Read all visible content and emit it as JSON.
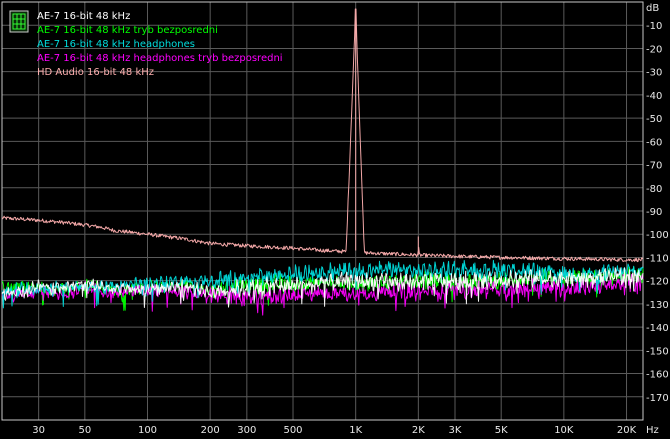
{
  "chart_data": {
    "type": "line",
    "x_scale": "log",
    "xlim": [
      20,
      24000
    ],
    "ylim": [
      -180,
      0
    ],
    "y_unit": "dB",
    "x_unit": "Hz",
    "grid": true,
    "legend_placement": "top-left",
    "x_ticks": [
      {
        "value": 30,
        "label": "30"
      },
      {
        "value": 50,
        "label": "50"
      },
      {
        "value": 100,
        "label": "100"
      },
      {
        "value": 200,
        "label": "200"
      },
      {
        "value": 300,
        "label": "300"
      },
      {
        "value": 500,
        "label": "500"
      },
      {
        "value": 1000,
        "label": "1K"
      },
      {
        "value": 2000,
        "label": "2K"
      },
      {
        "value": 3000,
        "label": "3K"
      },
      {
        "value": 5000,
        "label": "5K"
      },
      {
        "value": 10000,
        "label": "10K"
      },
      {
        "value": 20000,
        "label": "20K"
      }
    ],
    "y_ticks": [
      {
        "value": -10,
        "label": "-10"
      },
      {
        "value": -20,
        "label": "-20"
      },
      {
        "value": -30,
        "label": "-30"
      },
      {
        "value": -40,
        "label": "-40"
      },
      {
        "value": -50,
        "label": "-50"
      },
      {
        "value": -60,
        "label": "-60"
      },
      {
        "value": -70,
        "label": "-70"
      },
      {
        "value": -80,
        "label": "-80"
      },
      {
        "value": -90,
        "label": "-90"
      },
      {
        "value": -100,
        "label": "-100"
      },
      {
        "value": -110,
        "label": "-110"
      },
      {
        "value": -120,
        "label": "-120"
      },
      {
        "value": -130,
        "label": "-130"
      },
      {
        "value": -140,
        "label": "-140"
      },
      {
        "value": -150,
        "label": "-150"
      },
      {
        "value": -160,
        "label": "-160"
      },
      {
        "value": -170,
        "label": "-170"
      }
    ],
    "series": [
      {
        "name": "AE-7 16-bit 48 kHz",
        "color": "#ffffff",
        "points": [
          [
            20,
            -126
          ],
          [
            25,
            -124
          ],
          [
            30,
            -122
          ],
          [
            40,
            -123
          ],
          [
            50,
            -121
          ],
          [
            70,
            -123
          ],
          [
            100,
            -124
          ],
          [
            150,
            -122
          ],
          [
            200,
            -125
          ],
          [
            300,
            -123
          ],
          [
            500,
            -122
          ],
          [
            700,
            -121
          ],
          [
            1000,
            -120
          ],
          [
            1500,
            -121
          ],
          [
            2000,
            -120
          ],
          [
            3000,
            -120
          ],
          [
            5000,
            -120
          ],
          [
            7000,
            -119
          ],
          [
            10000,
            -119
          ],
          [
            15000,
            -119
          ],
          [
            20000,
            -118
          ],
          [
            24000,
            -118
          ]
        ]
      },
      {
        "name": "AE-7 16-bit 48 kHz tryb bezposredni",
        "color": "#00ff00",
        "points": [
          [
            20,
            -123
          ],
          [
            25,
            -122
          ],
          [
            30,
            -123
          ],
          [
            40,
            -124
          ],
          [
            50,
            -122
          ],
          [
            70,
            -124
          ],
          [
            100,
            -123
          ],
          [
            150,
            -122
          ],
          [
            200,
            -124
          ],
          [
            300,
            -122
          ],
          [
            500,
            -121
          ],
          [
            700,
            -121
          ],
          [
            1000,
            -121
          ],
          [
            1500,
            -121
          ],
          [
            2000,
            -120
          ],
          [
            3000,
            -120
          ],
          [
            5000,
            -120
          ],
          [
            7000,
            -119
          ],
          [
            10000,
            -119
          ],
          [
            15000,
            -119
          ],
          [
            20000,
            -118
          ],
          [
            24000,
            -118
          ]
        ]
      },
      {
        "name": "AE-7 16-bit 48 kHz headphones",
        "color": "#00dddd",
        "points": [
          [
            20,
            -125
          ],
          [
            25,
            -123
          ],
          [
            30,
            -124
          ],
          [
            40,
            -122
          ],
          [
            50,
            -123
          ],
          [
            70,
            -122
          ],
          [
            100,
            -121
          ],
          [
            150,
            -120
          ],
          [
            200,
            -120
          ],
          [
            300,
            -119
          ],
          [
            500,
            -117
          ],
          [
            700,
            -116
          ],
          [
            1000,
            -116
          ],
          [
            1500,
            -115
          ],
          [
            2000,
            -116
          ],
          [
            3000,
            -115
          ],
          [
            5000,
            -115
          ],
          [
            7000,
            -116
          ],
          [
            10000,
            -117
          ],
          [
            15000,
            -117
          ],
          [
            20000,
            -116
          ],
          [
            24000,
            -116
          ]
        ]
      },
      {
        "name": "AE-7 16-bit 48 kHz headphones tryb bezposredni",
        "color": "#ff00ff",
        "points": [
          [
            20,
            -127
          ],
          [
            25,
            -126
          ],
          [
            30,
            -124
          ],
          [
            40,
            -126
          ],
          [
            50,
            -123
          ],
          [
            70,
            -125
          ],
          [
            100,
            -124
          ],
          [
            150,
            -125
          ],
          [
            200,
            -126
          ],
          [
            300,
            -127
          ],
          [
            500,
            -126
          ],
          [
            700,
            -125
          ],
          [
            1000,
            -126
          ],
          [
            1500,
            -124
          ],
          [
            2000,
            -125
          ],
          [
            3000,
            -124
          ],
          [
            5000,
            -124
          ],
          [
            7000,
            -123
          ],
          [
            10000,
            -123
          ],
          [
            15000,
            -122
          ],
          [
            20000,
            -121
          ],
          [
            24000,
            -121
          ]
        ]
      },
      {
        "name": "HD Audio 16-bit 48 kHz",
        "color": "#ffb0b0",
        "points": [
          [
            20,
            -93
          ],
          [
            25,
            -93.5
          ],
          [
            30,
            -94
          ],
          [
            40,
            -95
          ],
          [
            50,
            -96
          ],
          [
            60,
            -97
          ],
          [
            70,
            -98.5
          ],
          [
            80,
            -99
          ],
          [
            100,
            -100
          ],
          [
            150,
            -102
          ],
          [
            200,
            -104
          ],
          [
            300,
            -105
          ],
          [
            500,
            -106
          ],
          [
            700,
            -107
          ],
          [
            900,
            -107.5
          ],
          [
            1000,
            -3
          ],
          [
            1100,
            -108
          ],
          [
            1500,
            -108.5
          ],
          [
            1990,
            -109
          ],
          [
            2000,
            -101
          ],
          [
            2010,
            -109
          ],
          [
            3000,
            -109.5
          ],
          [
            5000,
            -110
          ],
          [
            10000,
            -110.5
          ],
          [
            20000,
            -111
          ],
          [
            24000,
            -111
          ]
        ]
      }
    ]
  }
}
